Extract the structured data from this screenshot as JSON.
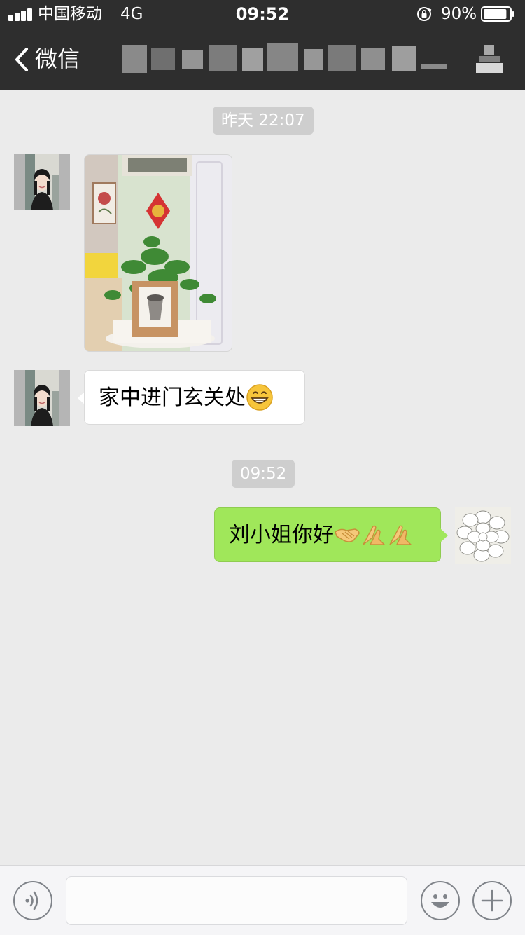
{
  "status_bar": {
    "carrier": "中国移动",
    "network": "4G",
    "time": "09:52",
    "battery_percent": "90%",
    "battery_level": 0.9,
    "icons": [
      "signal-icon",
      "orientation-lock-icon",
      "battery-icon"
    ]
  },
  "nav": {
    "back_label": "微信",
    "icons": [
      "chevron-left-icon",
      "contact-info-icon"
    ]
  },
  "messages": [
    {
      "type": "timestamp",
      "text": "昨天 22:07"
    },
    {
      "type": "image",
      "direction": "incoming",
      "sender_avatar": "girl-avatar",
      "content": "photo of potted plant in entryway"
    },
    {
      "type": "text",
      "direction": "incoming",
      "sender_avatar": "girl-avatar",
      "text": "家中进门玄关处",
      "emoji": [
        "grinning-face-icon"
      ]
    },
    {
      "type": "timestamp",
      "text": "09:52"
    },
    {
      "type": "text",
      "direction": "outgoing",
      "sender_avatar": "flower-avatar",
      "text": "刘小姐你好",
      "emoji": [
        "handshake-icon",
        "folded-hands-icon",
        "folded-hands-icon"
      ]
    }
  ],
  "input_bar": {
    "value": "",
    "placeholder": "",
    "icons": [
      "voice-icon",
      "emoji-face-icon",
      "plus-icon"
    ]
  },
  "colors": {
    "bar_background": "#2e2e2e",
    "chat_background": "#ebebeb",
    "outgoing_bubble": "#a0e75a",
    "incoming_bubble": "#ffffff",
    "timestamp_pill": "#cecece"
  }
}
